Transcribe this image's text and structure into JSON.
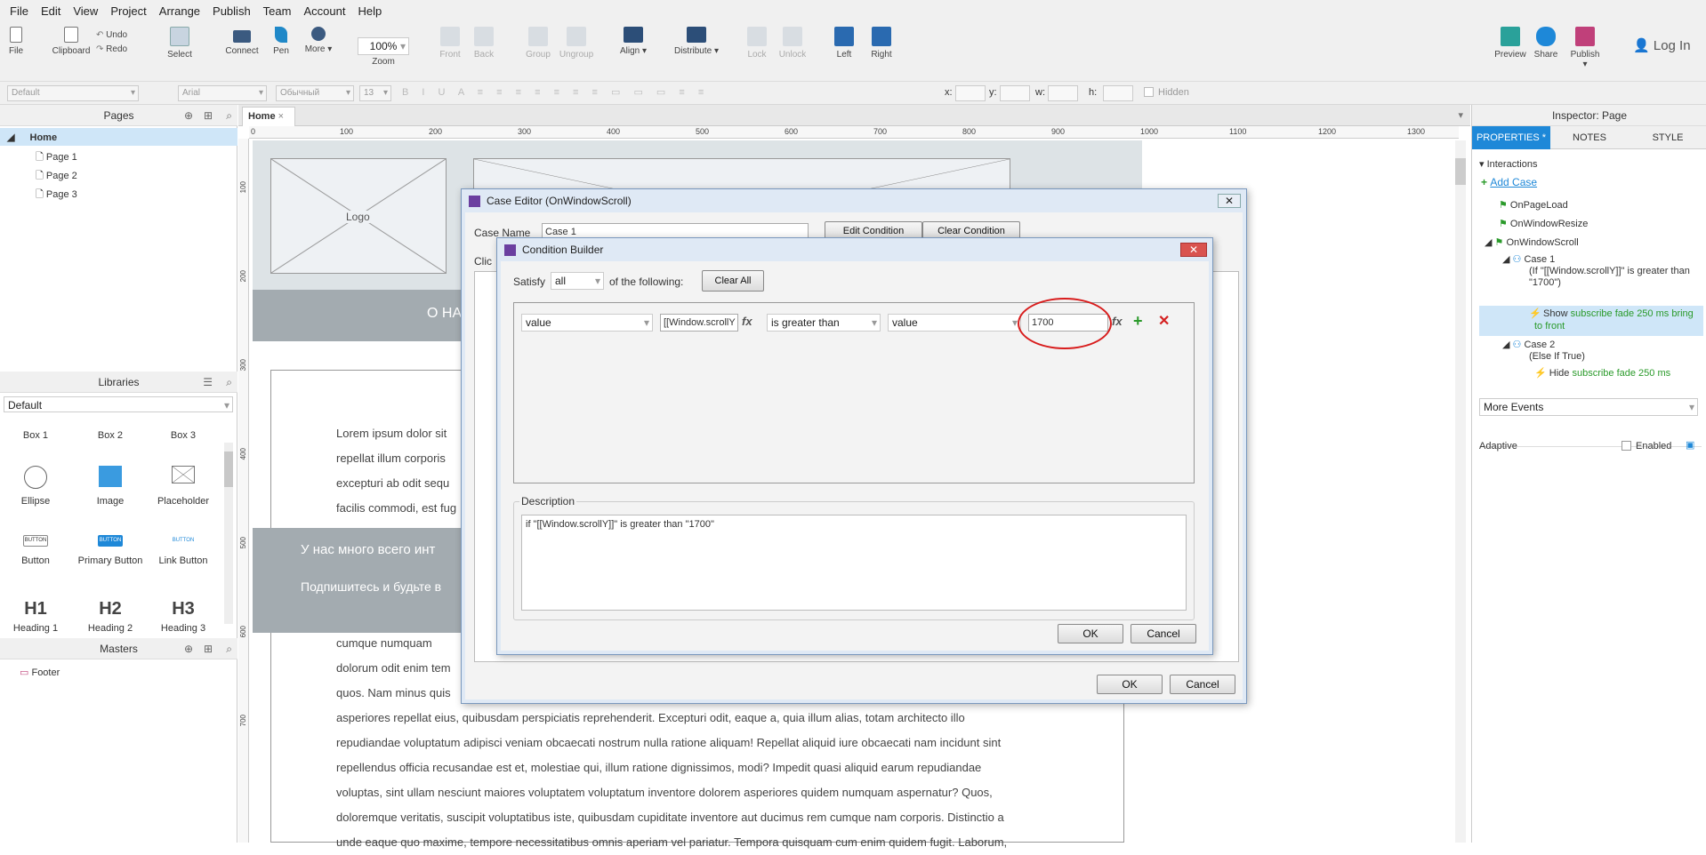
{
  "menu": [
    "File",
    "Edit",
    "View",
    "Project",
    "Arrange",
    "Publish",
    "Team",
    "Account",
    "Help"
  ],
  "toolbar": {
    "file": "File",
    "clipboard": "Clipboard",
    "undo": "Undo",
    "redo": "Redo",
    "select": "Select",
    "connect": "Connect",
    "pen": "Pen",
    "more": "More ▾",
    "zoom_value": "100%",
    "zoom": "Zoom",
    "front": "Front",
    "back": "Back",
    "group": "Group",
    "ungroup": "Ungroup",
    "align": "Align ▾",
    "distribute": "Distribute ▾",
    "lock": "Lock",
    "unlock": "Unlock",
    "left": "Left",
    "right": "Right",
    "preview": "Preview",
    "share": "Share",
    "publish": "Publish ▾",
    "login": "Log In"
  },
  "format": {
    "style": "Default",
    "font": "Arial",
    "weight": "Обычный",
    "size": "13",
    "x": "x:",
    "y": "y:",
    "w": "w:",
    "h": "h:",
    "hidden": "Hidden"
  },
  "pages": {
    "title": "Pages",
    "home": "Home",
    "items": [
      "Page 1",
      "Page 2",
      "Page 3"
    ]
  },
  "libraries": {
    "title": "Libraries",
    "selected": "Default",
    "items": [
      "Box 1",
      "Box 2",
      "Box 3",
      "Ellipse",
      "Image",
      "Placeholder",
      "Button",
      "Primary Button",
      "Link Button",
      "Heading 1",
      "Heading 2",
      "Heading 3"
    ],
    "button_glyph": "BUTTON",
    "h1": "H1",
    "h2": "H2",
    "h3": "H3"
  },
  "masters": {
    "title": "Masters",
    "items": [
      "Footer"
    ]
  },
  "canvas": {
    "tab": "Home",
    "ruler_top": [
      "0",
      "100",
      "200",
      "300",
      "400",
      "500",
      "600",
      "700",
      "800",
      "900",
      "1000",
      "1100",
      "1200",
      "1300"
    ],
    "ruler_left": [
      "100",
      "200",
      "300",
      "400",
      "500",
      "600",
      "700"
    ],
    "logo": "Logo",
    "banner_text": "О НА",
    "lorem_lines": [
      "Lorem ipsum dolor sit",
      "repellat illum corporis",
      "excepturi ab odit sequ",
      "facilis commodi, est fug"
    ],
    "subscribe_title": "У нас много всего инт",
    "subscribe_text": "Подпишитесь и будьте в",
    "body_lines": [
      "cumque numquam",
      "dolorum odit enim tem",
      "quos. Nam minus quis",
      "asperiores repellat eius, quibusdam perspiciatis reprehenderit. Excepturi odit, eaque a, quia illum alias, totam architecto illo",
      "repudiandae voluptatum adipisci veniam obcaecati nostrum nulla ratione aliquam! Repellat aliquid iure obcaecati nam incidunt sint",
      "repellendus officia recusandae est et, molestiae qui, illum ratione dignissimos, modi? Impedit quasi aliquid earum repudiandae",
      "voluptas, sint ullam nesciunt maiores voluptatem voluptatum inventore dolorem asperiores quidem numquam aspernatur? Quos,",
      "doloremque veritatis, suscipit voluptatibus iste, quibusdam cupiditate inventore aut ducimus rem cumque nam corporis. Distinctio a",
      "unde eaque quo maxime, tempore necessitatibus omnis aperiam vel pariatur. Tempora quisquam cum enim quidem fugit. Laborum,"
    ]
  },
  "case_editor": {
    "title": "Case Editor (OnWindowScroll)",
    "case_name_label": "Case Name",
    "case_name_value": "Case 1",
    "edit_condition": "Edit Condition",
    "clear_condition": "Clear Condition",
    "click_label": "Clic",
    "ok": "OK",
    "cancel": "Cancel"
  },
  "condition_builder": {
    "title": "Condition Builder",
    "satisfy": "Satisfy",
    "satisfy_value": "all",
    "of_following": "of the following:",
    "clear_all": "Clear All",
    "row": {
      "left_type": "value",
      "left_value": "[[Window.scrollY",
      "operator": "is greater than",
      "right_type": "value",
      "right_value": "1700",
      "fx": "fx"
    },
    "description_label": "Description",
    "description": "if \"[[Window.scrollY]]\" is greater than \"1700\"",
    "ok": "OK",
    "cancel": "Cancel"
  },
  "inspector": {
    "title": "Inspector: Page",
    "tabs": [
      "PROPERTIES *",
      "NOTES",
      "STYLE"
    ],
    "interactions": "Interactions",
    "add_case": "Add Case",
    "events": [
      "OnPageLoad",
      "OnWindowResize",
      "OnWindowScroll"
    ],
    "case1": "Case 1",
    "case1_cond": "(If \"[[Window.scrollY]]\" is greater than \"1700\")",
    "case1_action_verb": "Show",
    "case1_action": "subscribe fade 250 ms bring to front",
    "case2": "Case 2",
    "case2_cond": "(Else If True)",
    "case2_action_verb": "Hide",
    "case2_action": "subscribe fade 250 ms",
    "more_events": "More Events",
    "adaptive": "Adaptive",
    "enabled": "Enabled"
  },
  "colors": {
    "accent": "#1e88d8",
    "green": "#2a9a2a",
    "red": "#d42020",
    "banner": "#a3abb0"
  }
}
